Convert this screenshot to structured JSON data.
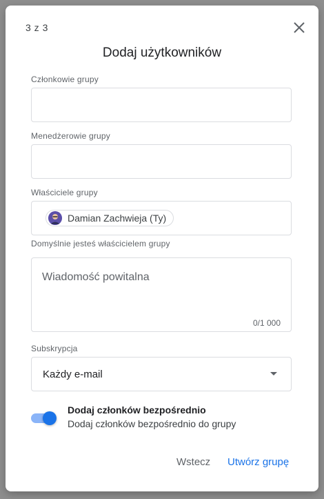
{
  "dialog": {
    "step": "3 z 3",
    "title": "Dodaj użytkowników"
  },
  "fields": {
    "members_label": "Członkowie grupy",
    "members_value": "",
    "managers_label": "Menedżerowie grupy",
    "managers_value": "",
    "owners_label": "Właściciele grupy",
    "owner_chip": "Damian Zachwieja (Ty)",
    "owners_helper": "Domyślnie jesteś właścicielem grupy"
  },
  "welcome_message": {
    "placeholder": "Wiadomość powitalna",
    "counter": "0/1 000"
  },
  "subscription": {
    "label": "Subskrypcja",
    "selected": "Każdy e-mail"
  },
  "toggle": {
    "title": "Dodaj członków bezpośrednio",
    "description": "Dodaj członków bezpośrednio do grupy",
    "on": true,
    "accent": "#1a73e8"
  },
  "buttons": {
    "back": "Wstecz",
    "create": "Utwórz grupę"
  },
  "icons": {
    "close": "close-icon",
    "dropdown": "chevron-down-icon",
    "avatar": "avatar"
  }
}
